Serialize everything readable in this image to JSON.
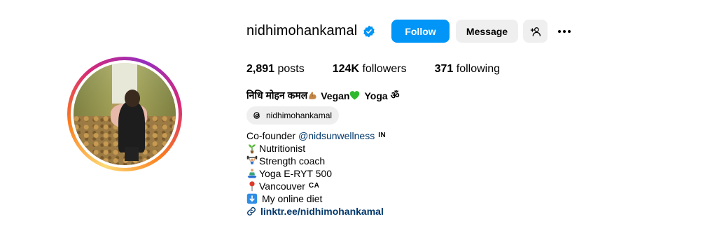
{
  "profile": {
    "username": "nidhimohankamal",
    "verified": true,
    "follow_label": "Follow",
    "message_label": "Message",
    "stats": {
      "posts_count": "2,891",
      "posts_label": "posts",
      "followers_count": "124K",
      "followers_label": "followers",
      "following_count": "371",
      "following_label": "following"
    },
    "full_name": {
      "name": "निधि मोहन कमल",
      "vegan": "Vegan",
      "yoga": "Yoga",
      "om": "ॐ"
    },
    "threads_handle": "nidhimohankamal",
    "bio": {
      "cofounder_prefix": "Co-founder",
      "cofounder_mention": "@nidsunwellness",
      "cofounder_flag": "IN",
      "line_nutritionist": "Nutritionist",
      "line_strength": "Strength coach",
      "line_yoga": "Yoga E-RYT 500",
      "line_location": "Vancouver",
      "location_flag": "CA",
      "line_diet": "My online diet",
      "link": "linktr.ee/nidhimohankamal"
    }
  },
  "icons": {
    "verified": "verified-badge-icon",
    "add_user": "add-person-icon",
    "more": "more-options-icon",
    "threads": "threads-icon",
    "muscle": "flexed-biceps-icon",
    "heart": "green-heart-icon",
    "sprout": "seedling-icon",
    "dumbbell": "weightlifter-icon",
    "yoga": "person-in-lotus-icon",
    "pin": "round-pushpin-icon",
    "down": "down-arrow-icon",
    "link": "link-icon"
  },
  "colors": {
    "follow_blue": "#0095f6",
    "button_gray": "#efefef",
    "link_blue": "#00376b",
    "verified_blue": "#0095f6"
  }
}
